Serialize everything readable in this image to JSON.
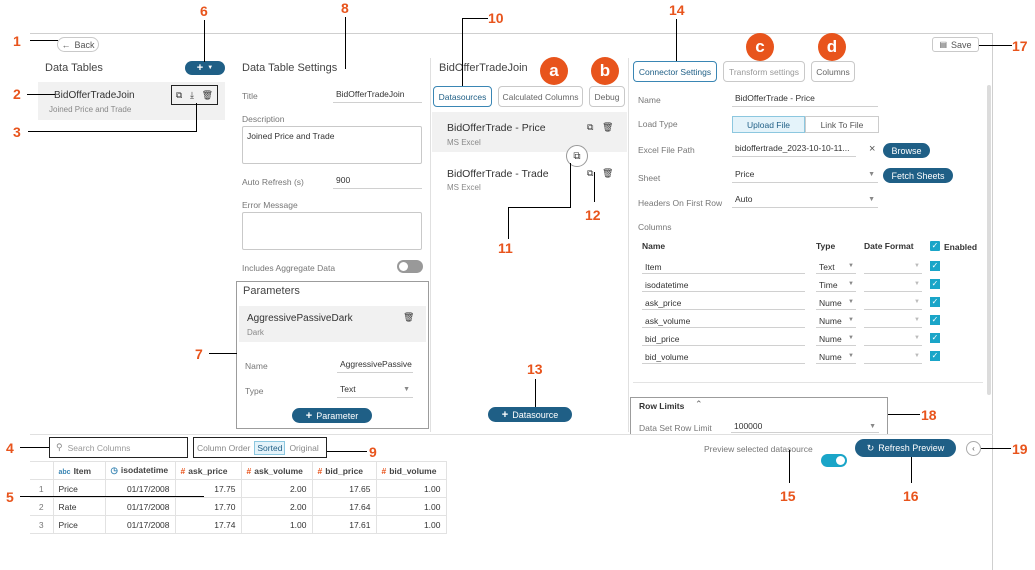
{
  "header": {
    "back_label": "Back",
    "save_label": "Save"
  },
  "data_tables": {
    "title": "Data Tables",
    "item": {
      "name": "BidOfferTradeJoin",
      "subtitle": "Joined Price and Trade"
    }
  },
  "table_settings": {
    "title": "Data Table Settings",
    "title_label": "Title",
    "title_value": "BidOfferTradeJoin",
    "description_label": "Description",
    "description_value": "Joined Price and Trade",
    "auto_refresh_label": "Auto Refresh (s)",
    "auto_refresh_value": "900",
    "error_label": "Error Message",
    "aggregate_label": "Includes Aggregate Data"
  },
  "parameters": {
    "title": "Parameters",
    "item_name": "AggressivePassiveDark",
    "item_sub": "Dark",
    "name_label": "Name",
    "name_value": "AggressivePassive",
    "type_label": "Type",
    "type_value": "Text",
    "add_label": "Parameter"
  },
  "datasources_panel": {
    "title": "BidOfferTradeJoin",
    "tabs": [
      "Datasources",
      "Calculated Columns",
      "Debug"
    ],
    "items": [
      {
        "name": "BidOfferTrade - Price",
        "type": "MS Excel"
      },
      {
        "name": "BidOfferTrade - Trade",
        "type": "MS Excel"
      }
    ],
    "add_label": "Datasource"
  },
  "connector": {
    "tabs": [
      "Connector Settings",
      "Transform settings",
      "Columns"
    ],
    "name_label": "Name",
    "name_value": "BidOfferTrade - Price",
    "load_type_label": "Load Type",
    "upload_label": "Upload File",
    "link_label": "Link To File",
    "path_label": "Excel File Path",
    "path_value": "bidoffertrade_2023-10-10-11...",
    "browse_label": "Browse",
    "sheet_label": "Sheet",
    "sheet_value": "Price",
    "fetch_label": "Fetch Sheets",
    "headers_label": "Headers On First Row",
    "headers_value": "Auto",
    "columns_label": "Columns",
    "col_headers": [
      "Name",
      "Type",
      "Date Format",
      "Enabled"
    ],
    "columns": [
      {
        "name": "Item",
        "type": "Text"
      },
      {
        "name": "isodatetime",
        "type": "Time"
      },
      {
        "name": "ask_price",
        "type": "Nume"
      },
      {
        "name": "ask_volume",
        "type": "Nume"
      },
      {
        "name": "bid_price",
        "type": "Nume"
      },
      {
        "name": "bid_volume",
        "type": "Nume"
      }
    ],
    "row_limits_title": "Row Limits",
    "row_limit_label": "Data Set Row Limit",
    "row_limit_value": "100000"
  },
  "preview": {
    "search_placeholder": "Search Columns",
    "column_order_label": "Column Order",
    "sorted_label": "Sorted",
    "original_label": "Original",
    "preview_label": "Preview selected datasource",
    "refresh_label": "Refresh Preview",
    "headers": [
      "Item",
      "isodatetime",
      "ask_price",
      "ask_volume",
      "bid_price",
      "bid_volume"
    ],
    "rows": [
      [
        "1",
        "Price",
        "01/17/2008",
        "17.75",
        "2.00",
        "17.65",
        "1.00"
      ],
      [
        "2",
        "Rate",
        "01/17/2008",
        "17.70",
        "2.00",
        "17.64",
        "1.00"
      ],
      [
        "3",
        "Price",
        "01/17/2008",
        "17.74",
        "1.00",
        "17.61",
        "1.00"
      ]
    ]
  },
  "callouts": {
    "n1": "1",
    "n2": "2",
    "n3": "3",
    "n4": "4",
    "n5": "5",
    "n6": "6",
    "n7": "7",
    "n8": "8",
    "n9": "9",
    "n10": "10",
    "n11": "11",
    "n12": "12",
    "n13": "13",
    "n14": "14",
    "n15": "15",
    "n16": "16",
    "n17": "17",
    "n18": "18",
    "n19": "19",
    "a": "a",
    "b": "b",
    "c": "c",
    "d": "d"
  },
  "colors": {
    "accent": "#1f5f86",
    "callout": "#e8541c",
    "toggle_on": "#1aa5c8"
  }
}
